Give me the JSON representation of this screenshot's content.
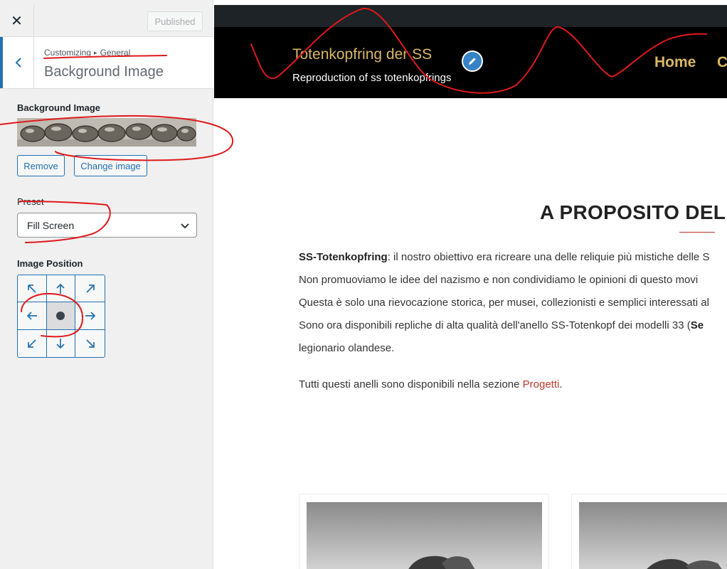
{
  "topbar": {
    "close_icon": "close-icon",
    "published_label": "Published"
  },
  "section": {
    "back_icon": "chevron-left-icon",
    "breadcrumb_parent": "Customizing",
    "breadcrumb_child": "General",
    "title": "Background Image"
  },
  "background_image": {
    "label": "Background Image",
    "remove_label": "Remove",
    "change_label": "Change image"
  },
  "preset": {
    "label": "Preset",
    "value": "Fill Screen"
  },
  "image_position": {
    "label": "Image Position",
    "selected": "center",
    "cells": [
      "top-left",
      "top",
      "top-right",
      "left",
      "center",
      "right",
      "bottom-left",
      "bottom",
      "bottom-right"
    ]
  },
  "site": {
    "title": "Totenkopfring der SS",
    "tagline": "Reproduction of ss totenkopfrings",
    "nav": [
      "Home",
      "C"
    ]
  },
  "content": {
    "heading": "A PROPOSITO DEL",
    "line1_bold": "SS-Totenkopfring",
    "line1_rest": ": il nostro obiettivo era ricreare una delle reliquie più mistiche delle S",
    "line2": "Non promuoviamo le idee del nazismo e non condividiamo le opinioni di questo movi",
    "line3": "Questa è solo una rievocazione storica, per musei, collezionisti e semplici interessati al",
    "line4_text": "Sono ora disponibili repliche di alta qualità dell'anello SS-Totenkopf dei modelli 33 (",
    "line4_bold": "Se",
    "line5": "legionario olandese.",
    "line6_text": "Tutti questi anelli sono disponibili nella sezione ",
    "line6_link": "Progetti",
    "line6_end": "."
  },
  "colors": {
    "accent": "#2271b1",
    "site_title": "#d9b865",
    "header_bg": "#000000",
    "link": "#c0392b",
    "annotation": "#e0191a"
  }
}
